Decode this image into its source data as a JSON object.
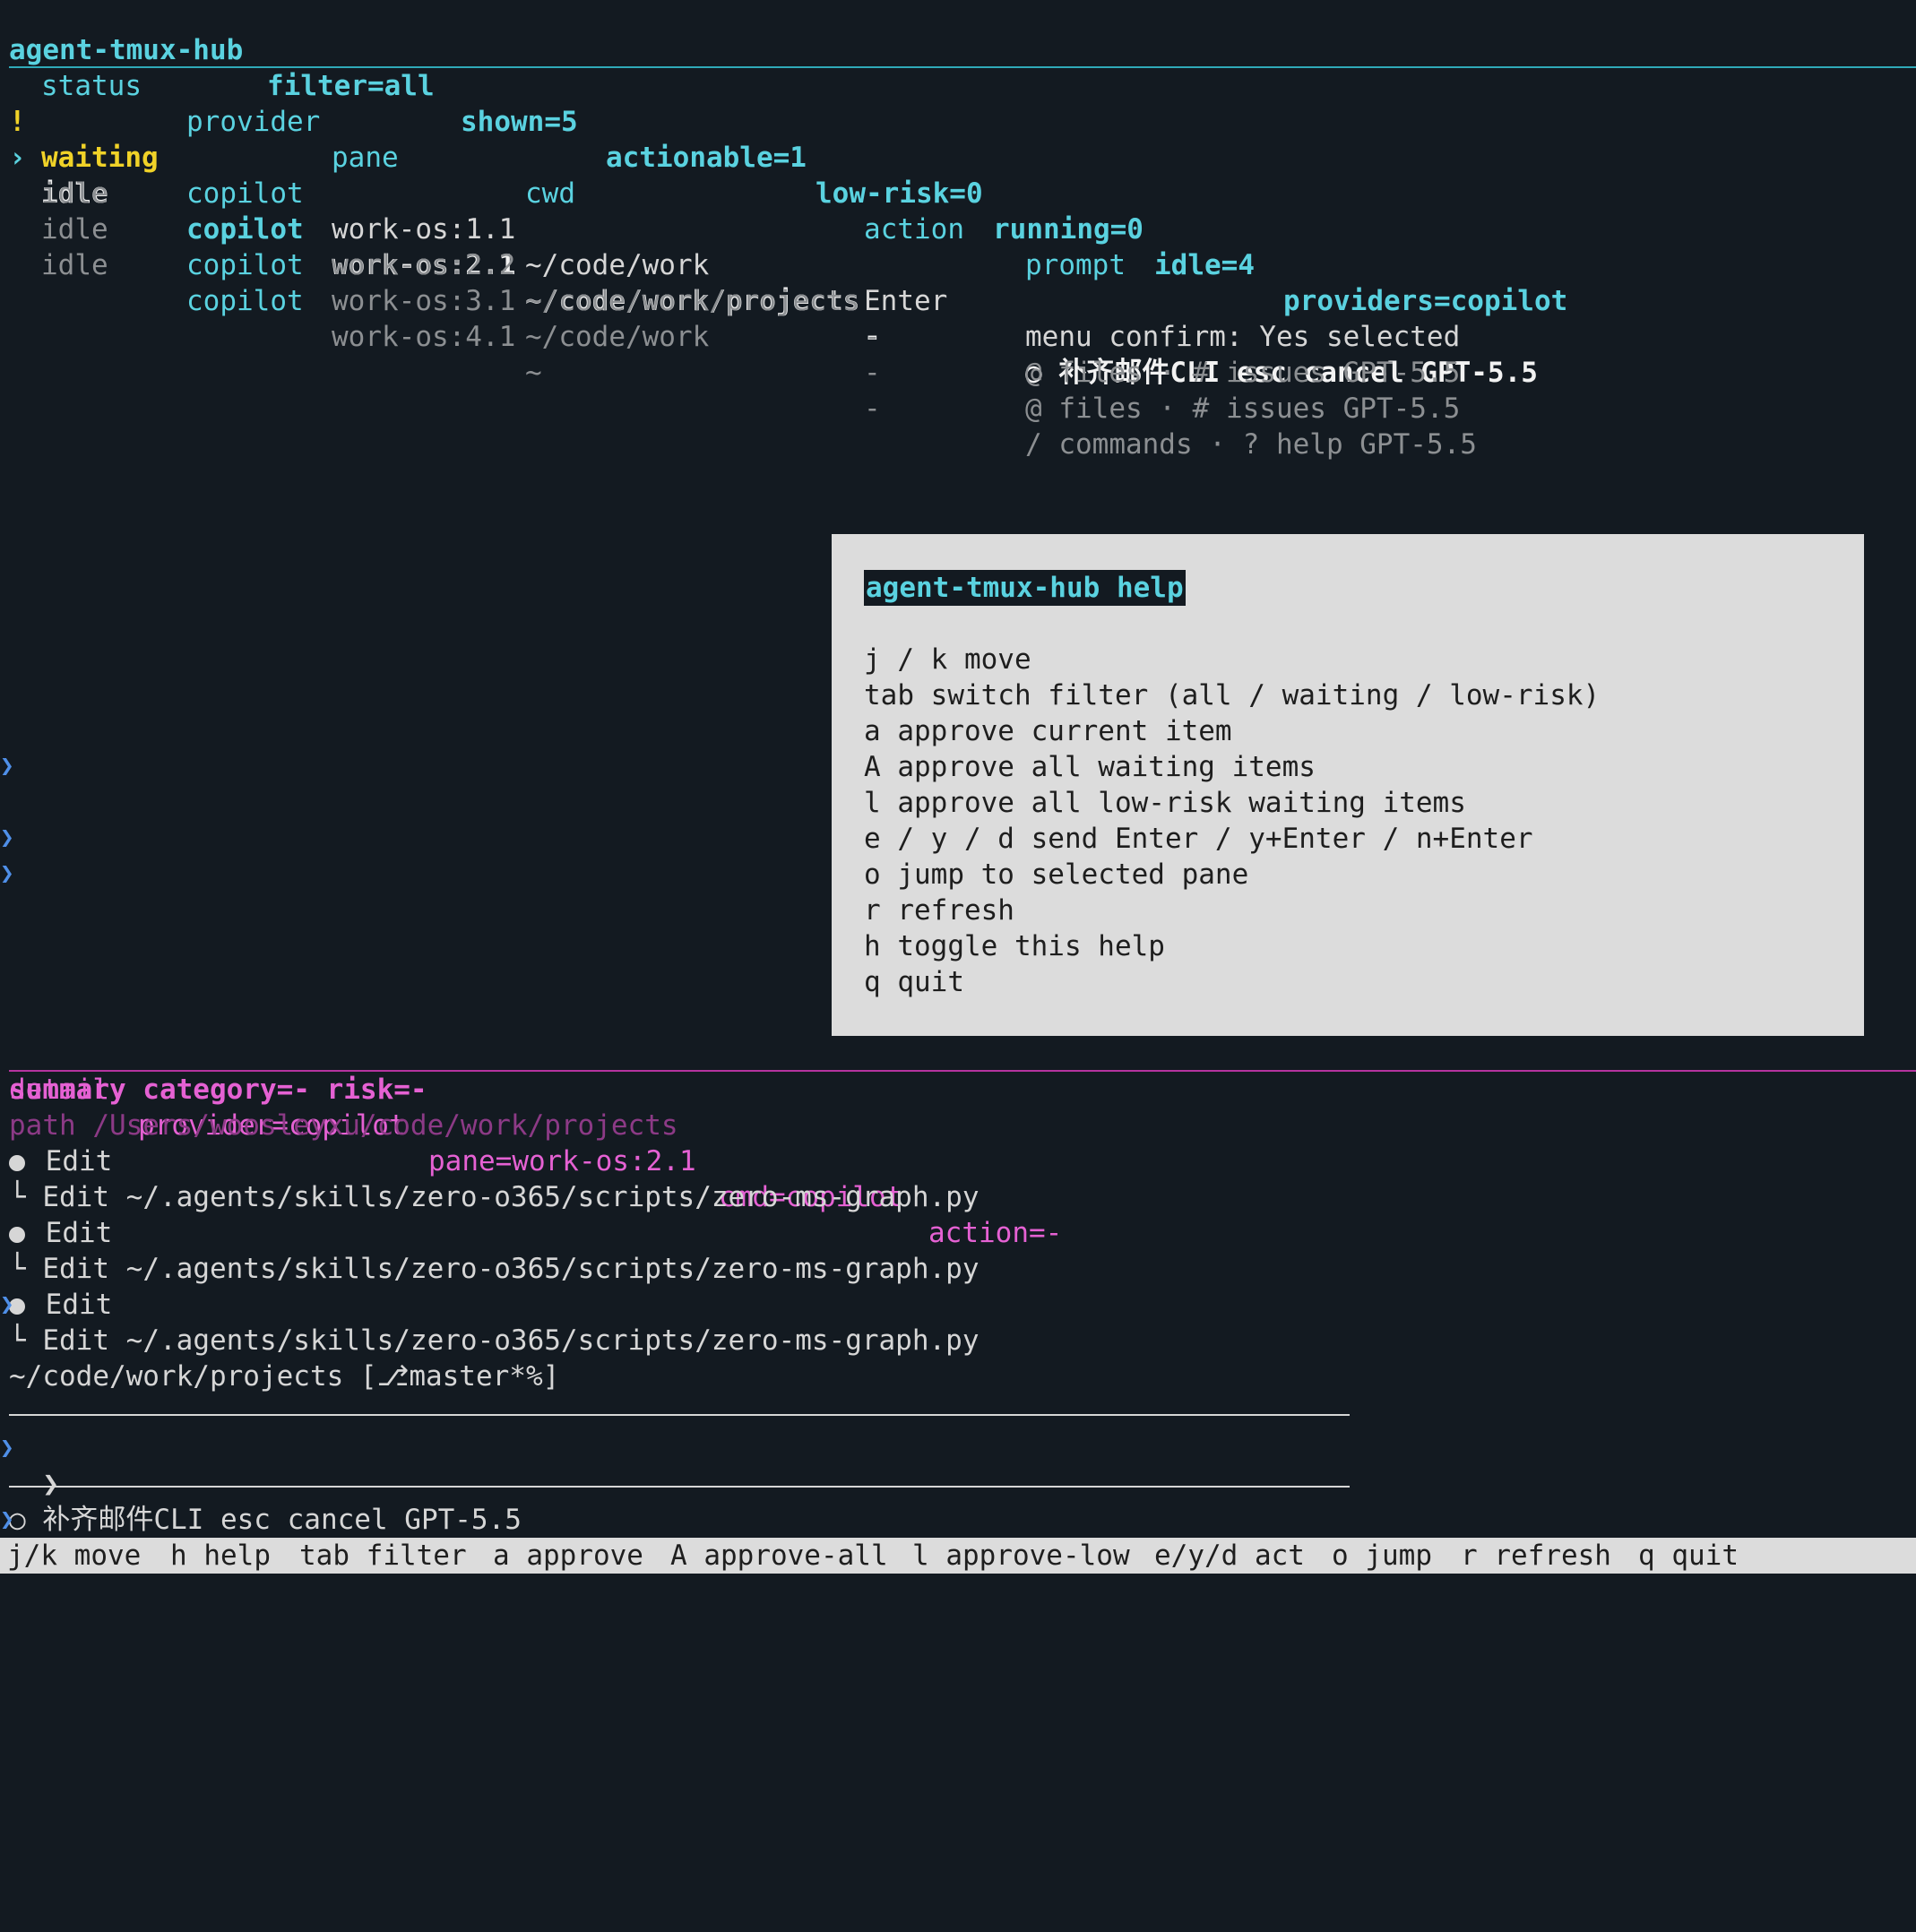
{
  "header": {
    "app": "agent-tmux-hub",
    "filter": "filter=all",
    "shown": "shown=5",
    "actionable": "actionable=1",
    "low_risk": "low-risk=0",
    "running": "running=0",
    "idle": "idle=4",
    "providers": "providers=copilot"
  },
  "table": {
    "columns": {
      "status": "status",
      "provider": "provider",
      "pane": "pane",
      "cwd": "cwd",
      "action": "action",
      "prompt": "prompt"
    },
    "rows": [
      {
        "flag": "!",
        "status": "waiting",
        "provider": "copilot",
        "pane": "work-os:1.1",
        "cwd": "~/code/work",
        "action": "Enter",
        "prompt": "menu confirm: Yes selected"
      },
      {
        "flag": "›",
        "status": "idle",
        "provider": "copilot",
        "pane": "work-os:2.1",
        "cwd": "~/code/work/projects",
        "action": "-",
        "prompt": "○ 补齐邮件CLI esc cancel GPT-5.5"
      },
      {
        "flag": "",
        "status": "idle",
        "provider": "copilot",
        "pane": "work-os:2.2",
        "cwd": "~/code/work/projects",
        "action": "-",
        "prompt": "@ files · # issues GPT-5.5"
      },
      {
        "flag": "",
        "status": "idle",
        "provider": "copilot",
        "pane": "work-os:3.1",
        "cwd": "~/code/work",
        "action": "-",
        "prompt": "@ files · # issues GPT-5.5"
      },
      {
        "flag": "",
        "status": "idle",
        "provider": "copilot",
        "pane": "work-os:4.1",
        "cwd": "~",
        "action": "-",
        "prompt": "/ commands · ? help GPT-5.5"
      }
    ]
  },
  "help": {
    "title": "agent-tmux-hub help",
    "lines": [
      "j / k move",
      "tab switch filter (all / waiting / low-risk)",
      "a approve current item",
      "A approve all waiting items",
      "l approve all low-risk waiting items",
      "e / y / d send Enter / y+Enter / n+Enter",
      "o jump to selected pane",
      "r refresh",
      "h toggle this help",
      "q quit"
    ]
  },
  "detail": {
    "label": "detail",
    "provider": "provider=copilot",
    "pane": "pane=work-os:2.1",
    "cmd": "cmd=copilot",
    "action": "action=-",
    "summary": "summary category=- risk=-",
    "path": "path /Users/woosleyxu/code/work/projects",
    "log": [
      {
        "head": "Edit",
        "sub": "Edit ~/.agents/skills/zero-o365/scripts/zero-ms-graph.py"
      },
      {
        "head": "Edit",
        "sub": "Edit ~/.agents/skills/zero-o365/scripts/zero-ms-graph.py"
      },
      {
        "head": "Edit",
        "sub": "Edit ~/.agents/skills/zero-o365/scripts/zero-ms-graph.py"
      }
    ],
    "sub_prefix": "└",
    "shell_prompt": "~/code/work/projects [⎇master*%]",
    "input_caret": "❯",
    "status_line": "○ 补齐邮件CLI esc cancel GPT-5.5"
  },
  "footer": {
    "items": [
      "j/k move",
      "h help",
      "tab filter",
      "a approve",
      "A approve-all",
      "l approve-low",
      "e/y/d act",
      "o jump",
      "r refresh",
      "q quit"
    ]
  },
  "colors": {
    "background": "#131a21",
    "cyan": "#5ad2e0",
    "yellow": "#f0d228",
    "magenta": "#e561d3",
    "help_bg": "#dcdcdc"
  }
}
